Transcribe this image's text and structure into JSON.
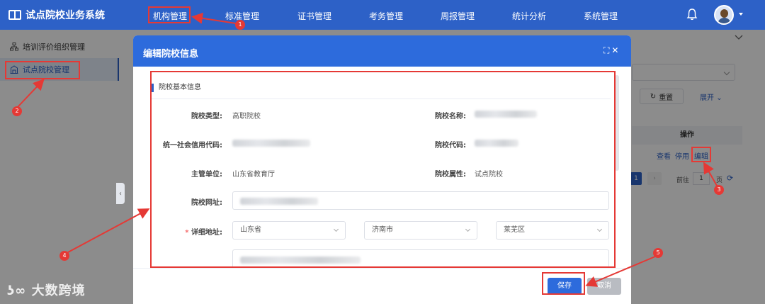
{
  "app": {
    "title": "试点院校业务系统"
  },
  "nav": {
    "items": [
      "机构管理",
      "标准管理",
      "证书管理",
      "考务管理",
      "周报管理",
      "统计分析",
      "系统管理"
    ]
  },
  "sidebar": {
    "items": [
      {
        "label": "培训评价组织管理",
        "icon": "org-tree-icon"
      },
      {
        "label": "试点院校管理",
        "icon": "building-icon"
      }
    ]
  },
  "background_page": {
    "reset_label": "重置",
    "expand_label": "展开",
    "ops_header": "操作",
    "ops_links": [
      "查看",
      "停用",
      "编辑"
    ],
    "pager": {
      "current": "1",
      "goto_label": "前往",
      "goto_value": "1",
      "page_unit": "页"
    }
  },
  "dialog": {
    "title": "编辑院校信息",
    "section_title": "院校基本信息",
    "fields": {
      "type_label": "院校类型:",
      "type_value": "高职院校",
      "name_label": "院校名称:",
      "credit_code_label": "统一社会信用代码:",
      "code_label": "院校代码:",
      "authority_label": "主管单位:",
      "authority_value": "山东省教育厅",
      "attr_label": "院校属性:",
      "attr_value": "试点院校",
      "website_label": "院校网址:",
      "address_label": "详细地址:",
      "address_required": "*",
      "province": "山东省",
      "city": "济南市",
      "district": "莱芜区"
    },
    "save_label": "保存",
    "cancel_label": "取消"
  },
  "annotations": [
    "1",
    "2",
    "3",
    "4",
    "5"
  ],
  "watermark": "大数跨境",
  "colors": {
    "primary": "#2d61c7",
    "annotation": "#e53935"
  }
}
